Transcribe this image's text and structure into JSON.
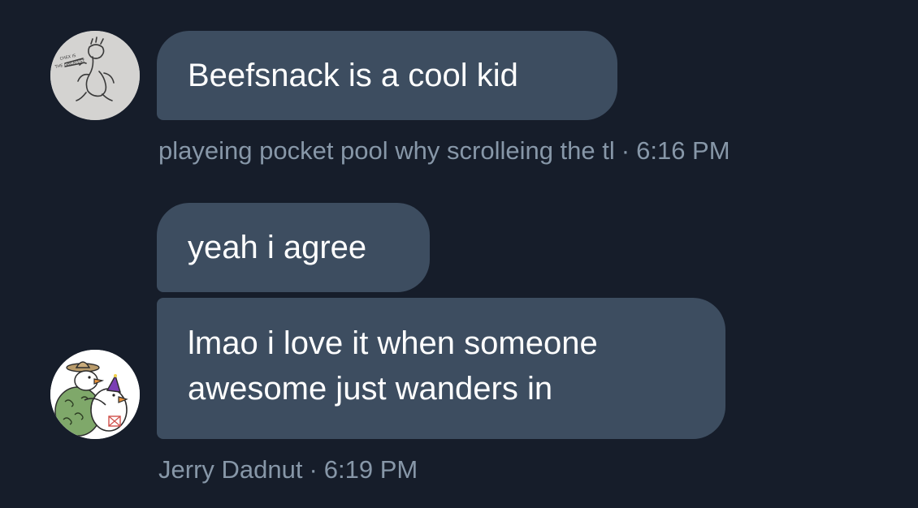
{
  "colors": {
    "background": "#161d2a",
    "bubble": "#3d4d60",
    "message_text": "#ffffff",
    "meta_text": "#8797a8"
  },
  "conversation": [
    {
      "sender_avatar": "sketch-doodle-avatar",
      "messages": [
        "Beefsnack is a cool kid"
      ],
      "sender_name": "playeing pocket pool why scrolleing the tl",
      "separator": "·",
      "time": "6:16 PM"
    },
    {
      "sender_avatar": "cartoon-birds-avatar",
      "messages": [
        "yeah i agree",
        "lmao i love it when someone",
        "awesome just wanders in"
      ],
      "sender_name": "Jerry Dadnut",
      "separator": "·",
      "time": "6:19 PM"
    }
  ]
}
